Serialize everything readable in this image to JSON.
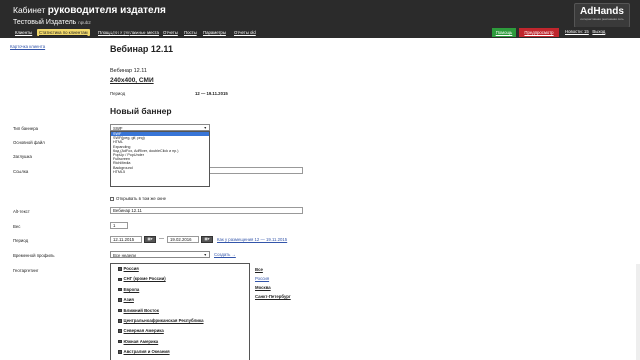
{
  "header": {
    "title_prefix": "Кабинет",
    "title_bold": "руководителя издателя",
    "publisher": "Тестовый Издатель",
    "publisher_id": "npub2",
    "logo_text": "AdHands",
    "logo_sub": "интерактивная рекламная сеть",
    "nav": [
      "Клиенты",
      "Статистика по клиентам",
      "Площадки и рекламные места",
      "Отчеты",
      "Посты",
      "Параметры",
      "Отчеты old"
    ],
    "active_nav": 1,
    "help": "Помощь",
    "preview": "Предпросмотр",
    "news": "Новости: 15",
    "exit": "Выход"
  },
  "breadcrumb": "Карточка клиента",
  "campaign_link": "Вебинар 12.11",
  "section_title": "Вебинар 12.11",
  "webinar_name": "Вебинар 12.11",
  "banner_size": "240x400, СМИ",
  "period_label": "Период",
  "period_value": "12 — 19.11.2015",
  "new_banner_title": "Новый баннер",
  "form": {
    "banner_type_label": "Тип баннера",
    "banner_type_value": "SWF",
    "main_file_label": "Основной файл",
    "stub_label": "Заглушка",
    "link_label": "Ссылка",
    "open_new_window": "Открывать в том же окне",
    "alt_label": "Alt-текст",
    "alt_value": "Вебинар 12.11",
    "weight_label": "Вес",
    "weight_value": "1",
    "period_label": "Период",
    "date_from": "12.11.2015",
    "date_to": "19.02.2016",
    "period_link": "Как у размещения 12 — 19.11.2015",
    "time_profile_label": "Временной профиль",
    "time_profile_value": "Все недели",
    "time_profile_link": "Создать →",
    "geo_label": "Геотаргетинг"
  },
  "banner_types": [
    "SWF",
    "SWF(jpeg, gif, png)",
    "HTML",
    "Expanding",
    "Код (AdFox, AdRiver, doubleClick и пр.)",
    "PopUp / PopUnder",
    "Fullscreen",
    "RichMedia",
    "Background",
    "HTML5"
  ],
  "geo_items": [
    "Россия",
    "СНГ (кроме России)",
    "Европа",
    "Азия",
    "Ближний Восток",
    "Центральноафриканская Республика",
    "Северная Америка",
    "Южная Америка",
    "Австралия и Океания"
  ],
  "geo_links": [
    "Все",
    "Россия",
    "Москва",
    "Санкт-Петербург"
  ]
}
